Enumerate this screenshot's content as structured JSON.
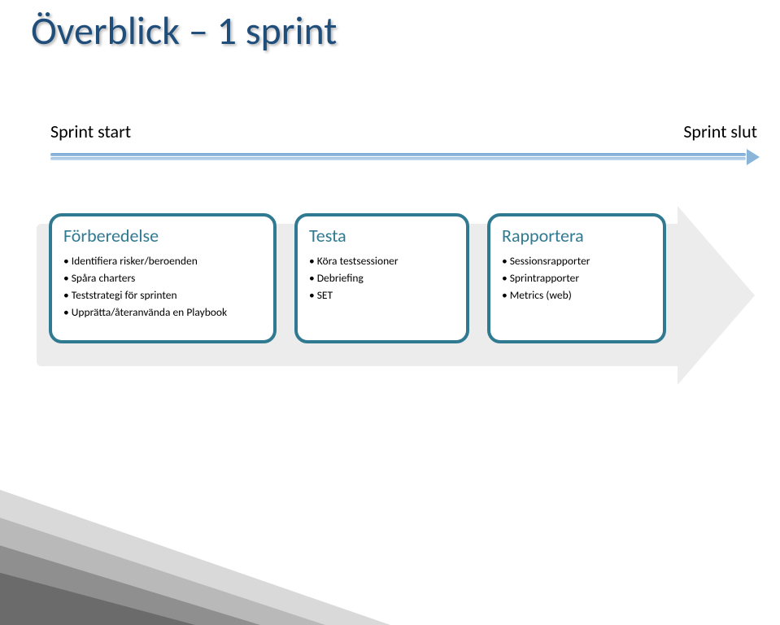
{
  "title": "Överblick – 1 sprint",
  "labels": {
    "start": "Sprint start",
    "end": "Sprint slut"
  },
  "cards": [
    {
      "title": "Förberedelse",
      "items": [
        "Identifiera risker/beroenden",
        "Spåra charters",
        "Teststrategi för sprinten",
        "Upprätta/återanvända en Playbook"
      ]
    },
    {
      "title": "Testa",
      "items": [
        "Köra testsessioner",
        "Debriefing",
        "SET"
      ]
    },
    {
      "title": "Rapportera",
      "items": [
        "Sessionsrapporter",
        "Sprintrapporter",
        "Metrics (web)"
      ]
    }
  ],
  "colors": {
    "title": "#1f4e7a",
    "card_border": "#2f7a91",
    "bg_arrow": "#ececec",
    "timeline": "#8ab4d8"
  }
}
